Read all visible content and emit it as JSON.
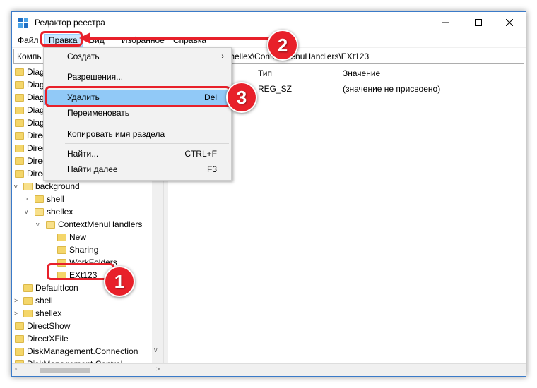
{
  "window": {
    "title": "Редактор реестра"
  },
  "menubar": {
    "file": "Файл",
    "edit": "Правка",
    "view": "Вид",
    "favorites": "Избранное",
    "help": "Справка"
  },
  "address": {
    "visible_left": "Компь",
    "visible_right": "\\shellex\\ContextMenuHandlers\\EXt123",
    "hidden_mid": "C"
  },
  "tree": {
    "items": [
      {
        "label": "Diag"
      },
      {
        "label": "Diag"
      },
      {
        "label": "Diag"
      },
      {
        "label": "Diag"
      },
      {
        "label": "Diag"
      },
      {
        "label": "Direc"
      },
      {
        "label": "Direc"
      },
      {
        "label": "Direc"
      },
      {
        "label": "Direc"
      },
      {
        "label": "background"
      },
      {
        "label": "shell"
      },
      {
        "label": "shellex"
      },
      {
        "label": "ContextMenuHandlers"
      },
      {
        "label": "New"
      },
      {
        "label": "Sharing"
      },
      {
        "label": "WorkFolders"
      },
      {
        "label": "EXt123"
      },
      {
        "label": "DefaultIcon"
      },
      {
        "label": "shell"
      },
      {
        "label": "shellex"
      },
      {
        "label": "DirectShow"
      },
      {
        "label": "DirectXFile"
      },
      {
        "label": "DiskManagement.Connection"
      },
      {
        "label": "DiskManagement.Control"
      }
    ]
  },
  "list": {
    "columns": {
      "type": "Тип",
      "value": "Значение"
    },
    "rows": [
      {
        "type": "REG_SZ",
        "value": "(значение не присвоено)"
      }
    ]
  },
  "edit_menu": {
    "items": [
      {
        "label": "Создать",
        "shortcut": "",
        "submenu": true
      },
      {
        "label": "Разрешения...",
        "shortcut": ""
      },
      {
        "label": "Удалить",
        "shortcut": "Del"
      },
      {
        "label": "Переименовать",
        "shortcut": ""
      },
      {
        "label": "Копировать имя раздела",
        "shortcut": ""
      },
      {
        "label": "Найти...",
        "shortcut": "CTRL+F"
      },
      {
        "label": "Найти далее",
        "shortcut": "F3"
      }
    ],
    "submenu_arrow": "›"
  },
  "annotations": {
    "badge1": "1",
    "badge2": "2",
    "badge3": "3",
    "color": "#e8202a"
  },
  "icons": {
    "app": "registry-editor-icon",
    "folder": "folder-icon",
    "minimize": "minimize-icon",
    "maximize": "maximize-icon",
    "close": "close-icon"
  }
}
